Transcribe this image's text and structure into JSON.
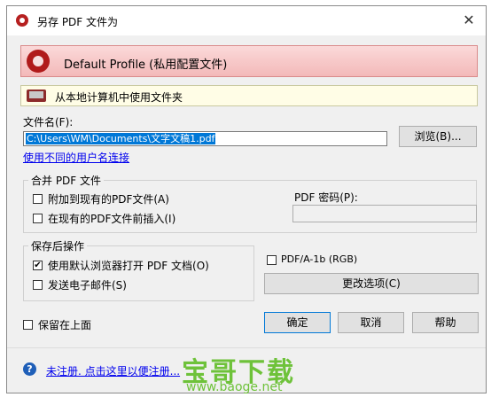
{
  "window": {
    "title": "另存 PDF 文件为",
    "close_glyph": "✕"
  },
  "profile": {
    "label": "Default Profile (私用配置文件)"
  },
  "local": {
    "label": "从本地计算机中使用文件夹"
  },
  "filename": {
    "label": "文件名(F):",
    "value": "C:\\Users\\WM\\Documents\\文字文稿1.pdf",
    "browse_label": "浏览(B)...",
    "other_user_link": "使用不同的用户名连接"
  },
  "merge": {
    "legend": "合并 PDF 文件",
    "append_label": "附加到现有的PDF文件(A)",
    "append_checked": false,
    "insert_label": "在现有的PDF文件前插入(I)",
    "insert_checked": false,
    "password_label": "PDF 密码(P):",
    "password_value": ""
  },
  "after_save": {
    "legend": "保存后操作",
    "open_label": "使用默认浏览器打开 PDF 文档(O)",
    "open_checked": true,
    "email_label": "发送电子邮件(S)",
    "email_checked": false
  },
  "pdfa": {
    "label": "PDF/A-1b (RGB)",
    "checked": false,
    "change_options_label": "更改选项(C)"
  },
  "stay_on_top": {
    "label": "保留在上面",
    "checked": false
  },
  "buttons": {
    "ok": "确定",
    "cancel": "取消",
    "help": "帮助"
  },
  "footer": {
    "help_glyph": "?",
    "register_link": "未注册. 点击这里以便注册..."
  },
  "watermark": {
    "main": "宝哥下载",
    "url": "www.baoge.net"
  },
  "check_glyph": "✔"
}
